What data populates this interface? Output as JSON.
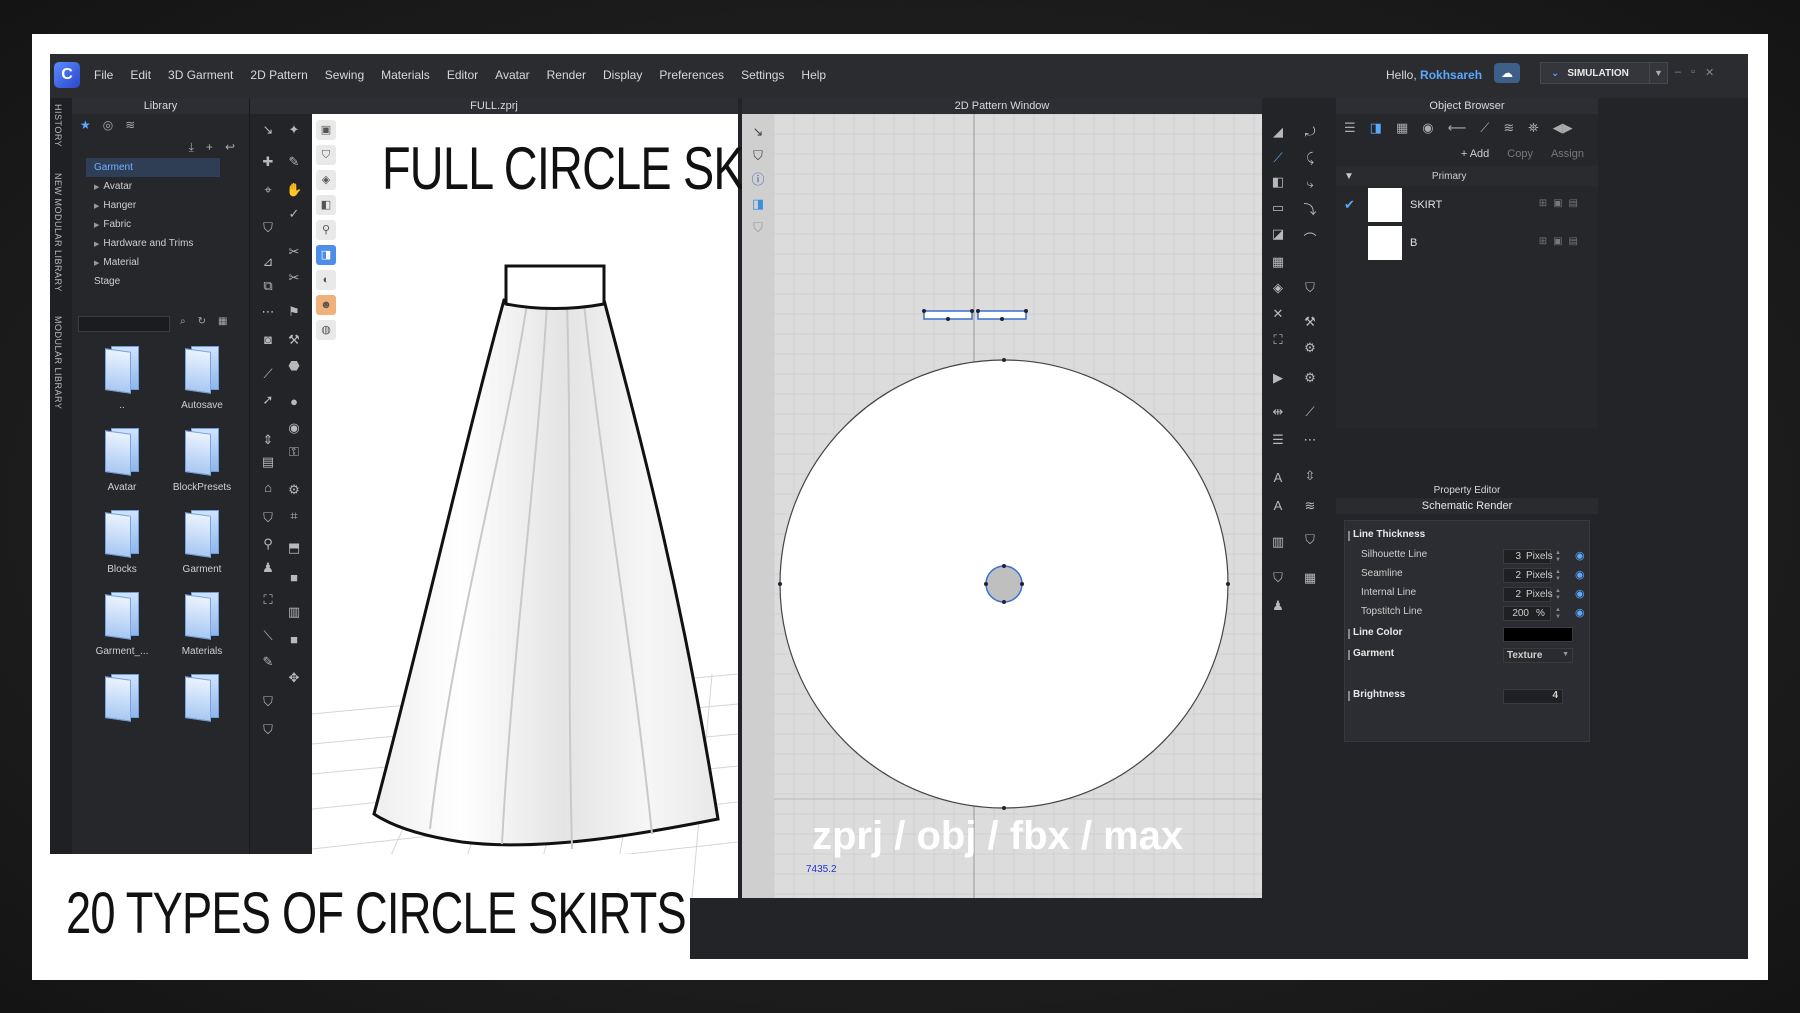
{
  "app": {
    "logo_glyph": "C",
    "menu": [
      "File",
      "Edit",
      "3D Garment",
      "2D Pattern",
      "Sewing",
      "Materials",
      "Editor",
      "Avatar",
      "Render",
      "Display",
      "Preferences",
      "Settings",
      "Help"
    ],
    "greeting_prefix": "Hello,",
    "username": "Rokhsareh",
    "simulation_label": "SIMULATION",
    "accent_color": "#5aa8ff"
  },
  "side_tabs": [
    "HISTORY",
    "NEW MODULAR LIBRARY",
    "MODULAR LIBRARY"
  ],
  "library": {
    "title": "Library",
    "tree": [
      {
        "label": "Garment",
        "selected": true,
        "expandable": false
      },
      {
        "label": "Avatar",
        "selected": false,
        "expandable": true
      },
      {
        "label": "Hanger",
        "selected": false,
        "expandable": true
      },
      {
        "label": "Fabric",
        "selected": false,
        "expandable": true
      },
      {
        "label": "Hardware and Trims",
        "selected": false,
        "expandable": true
      },
      {
        "label": "Material",
        "selected": false,
        "expandable": true
      },
      {
        "label": "Stage",
        "selected": false,
        "expandable": false
      }
    ],
    "folders": [
      "..",
      "Autosave",
      "Avatar",
      "BlockPresets",
      "Blocks",
      "Garment",
      "Garment_...",
      "Materials",
      "",
      ""
    ]
  },
  "viewport3d": {
    "file_title": "FULL.zprj",
    "overlay_title": "FULL CIRCLE SKIRT"
  },
  "pattern2d": {
    "title": "2D Pattern Window",
    "formats_text": "zprj / obj / fbx / max",
    "coordinate_readout": "7435.2"
  },
  "object_browser": {
    "title": "Object Browser",
    "add_label": "+ Add",
    "copy_label": "Copy",
    "assign_label": "Assign",
    "colorway_label": "Primary",
    "items": [
      {
        "name": "SKIRT",
        "checked": true
      },
      {
        "name": "B",
        "checked": false
      }
    ]
  },
  "property_editor": {
    "title": "Property Editor",
    "subtitle": "Schematic Render",
    "line_thickness_label": "Line Thickness",
    "rows": [
      {
        "label": "Silhouette Line",
        "value": "3",
        "unit": "Pixels"
      },
      {
        "label": "Seamline",
        "value": "2",
        "unit": "Pixels"
      },
      {
        "label": "Internal Line",
        "value": "2",
        "unit": "Pixels"
      },
      {
        "label": "Topstitch Line",
        "value": "200",
        "unit": "%"
      }
    ],
    "line_color_label": "Line Color",
    "line_color": "#000000",
    "garment_label": "Garment",
    "garment_value": "Texture",
    "brightness_label": "Brightness",
    "brightness_value": "4"
  },
  "caption": "20 TYPES OF CIRCLE SKIRTS"
}
